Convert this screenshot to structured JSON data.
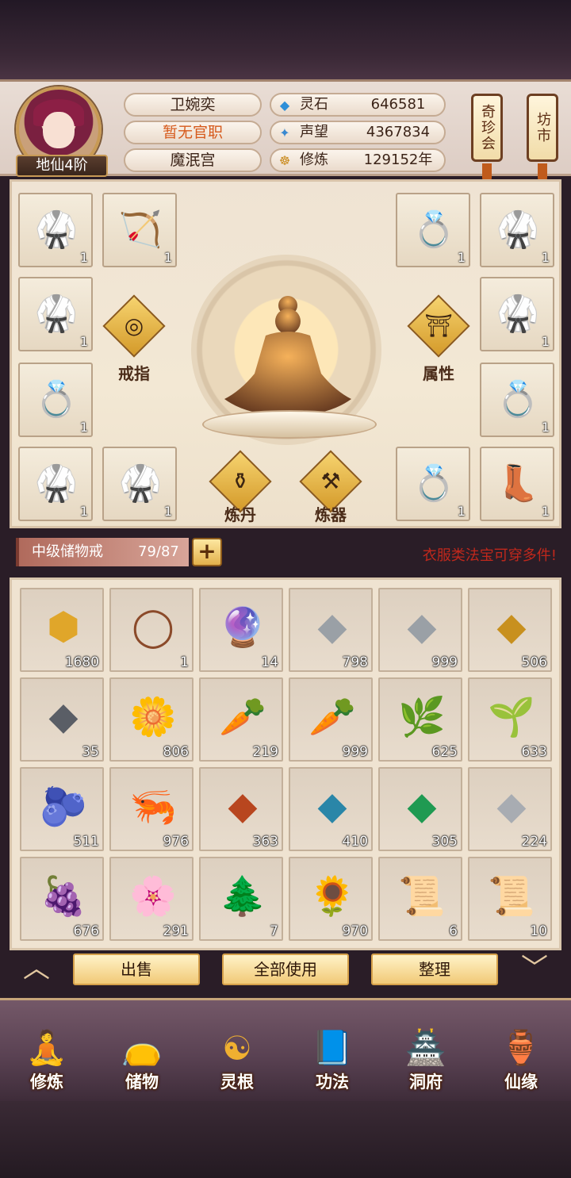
{
  "player": {
    "name": "卫婉奕",
    "official_rank": "暂无官职",
    "sect": "魔泯宫",
    "cultivation_level": "地仙4阶"
  },
  "resources": [
    {
      "label": "灵石",
      "value": "646581",
      "icon": "spirit-stone-icon"
    },
    {
      "label": "声望",
      "value": "4367834",
      "icon": "prestige-icon"
    },
    {
      "label": "修炼",
      "value": "129152年",
      "icon": "meditation-icon"
    }
  ],
  "shortcuts": {
    "treasure_fair": "奇珍会",
    "market": "坊市"
  },
  "colors": {
    "rank_text": "#d65a1c",
    "tip_text": "#c0281c",
    "accent_gold": "#e3b14c"
  },
  "equipment": {
    "slots_left": [
      {
        "icon": "armor-icon",
        "count": "1"
      },
      {
        "icon": "bow-icon",
        "count": "1"
      },
      {
        "icon": "armor-icon",
        "count": "1"
      },
      {
        "icon": "ring-icon",
        "count": "1"
      },
      {
        "icon": "armor-icon",
        "count": "1"
      },
      {
        "icon": "armor-icon",
        "count": "1"
      }
    ],
    "slots_right": [
      {
        "icon": "ring-icon",
        "count": "1"
      },
      {
        "icon": "armor-icon",
        "count": "1"
      },
      {
        "icon": "armor-icon",
        "count": "1"
      },
      {
        "icon": "ring-icon",
        "count": "1"
      },
      {
        "icon": "ring-icon",
        "count": "1"
      },
      {
        "icon": "boots-icon",
        "count": "1"
      }
    ],
    "functions": {
      "ring": "戒指",
      "attributes": "属性",
      "alchemy": "炼丹",
      "forging": "炼器"
    }
  },
  "bag": {
    "name": "中级储物戒",
    "capacity": "79/87",
    "tip": "衣服类法宝可穿多件!",
    "items": [
      {
        "icon": "gold-rune-stone-icon",
        "count": "1680"
      },
      {
        "icon": "wooden-ring-icon",
        "count": "1"
      },
      {
        "icon": "crystal-orb-icon",
        "count": "14"
      },
      {
        "icon": "iron-ore-icon",
        "count": "798"
      },
      {
        "icon": "iron-ore-icon",
        "count": "999"
      },
      {
        "icon": "gold-ore-icon",
        "count": "506"
      },
      {
        "icon": "dark-ore-icon",
        "count": "35"
      },
      {
        "icon": "white-lily-icon",
        "count": "806"
      },
      {
        "icon": "ginseng-icon",
        "count": "219"
      },
      {
        "icon": "ginseng-icon",
        "count": "999"
      },
      {
        "icon": "herb-root-icon",
        "count": "625"
      },
      {
        "icon": "herb-flower-icon",
        "count": "633"
      },
      {
        "icon": "berry-branch-icon",
        "count": "511"
      },
      {
        "icon": "cordyceps-icon",
        "count": "976"
      },
      {
        "icon": "red-crystal-icon",
        "count": "363"
      },
      {
        "icon": "blue-crystal-icon",
        "count": "410"
      },
      {
        "icon": "green-crystal-icon",
        "count": "305"
      },
      {
        "icon": "silver-ore-icon",
        "count": "224"
      },
      {
        "icon": "purple-berry-icon",
        "count": "676"
      },
      {
        "icon": "purple-flower-icon",
        "count": "291"
      },
      {
        "icon": "green-herb-icon",
        "count": "7"
      },
      {
        "icon": "lotus-pod-icon",
        "count": "970"
      },
      {
        "icon": "scroll-treasure-icon",
        "count": "6"
      },
      {
        "icon": "scroll-treasure-icon",
        "count": "10"
      }
    ],
    "actions": {
      "sell": "出售",
      "use_all": "全部使用",
      "sort": "整理"
    }
  },
  "nav": [
    {
      "label": "修炼",
      "icon": "cultivate-icon"
    },
    {
      "label": "储物",
      "icon": "storage-bag-icon"
    },
    {
      "label": "灵根",
      "icon": "spirit-root-icon"
    },
    {
      "label": "功法",
      "icon": "technique-book-icon"
    },
    {
      "label": "洞府",
      "icon": "cave-mansion-icon"
    },
    {
      "label": "仙缘",
      "icon": "immortal-fate-icon"
    }
  ]
}
